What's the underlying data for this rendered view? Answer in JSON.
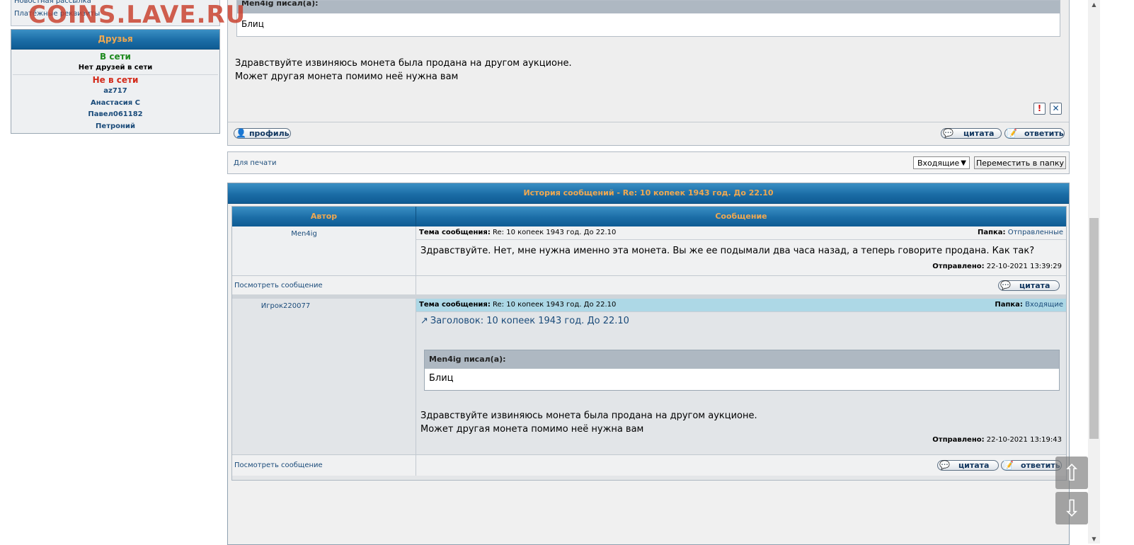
{
  "watermark": "COINS.LAVE.RU",
  "sidebar": {
    "top_links": [
      "Новостная рассылка",
      "Платёжные реквизиты"
    ],
    "friends": {
      "title": "Друзья",
      "online_label": "В сети",
      "no_friends_online": "Нет друзей в сети",
      "offline_label": "Не в сети",
      "offline_names": [
        "az717",
        "Анастасия С",
        "Павел061182",
        "Петроний"
      ]
    }
  },
  "top_post": {
    "quote_header": "Men4ig писал(а):",
    "quote_body": "Блиц",
    "body_lines": [
      "Здравствуйте извиняюсь монета была продана на другом аукционе.",
      "Может другая монета помимо неё нужна вам"
    ],
    "report_icon": "!",
    "delete_icon": "✕",
    "profile_button": "профиль",
    "quote_button": "цитата",
    "reply_button": "ответить"
  },
  "print_bar": {
    "print_link": "Для печати",
    "folder_selected": "Входящие",
    "move_button": "Переместить в папку"
  },
  "history": {
    "title": "История сообщений - Re: 10 копеек 1943 год. До 22.10",
    "col_author": "Автор",
    "col_message": "Сообщение",
    "topic_label": "Тема сообщения:",
    "folder_label": "Папка:",
    "sent_label": "Отправлено:",
    "view_link": "Посмотреть сообщение",
    "quote_button": "цитата",
    "reply_button": "ответить",
    "messages": [
      {
        "author": "Men4ig",
        "topic": "Re: 10 копеек 1943 год. До 22.10",
        "folder": "Отправленные",
        "body": "Здравствуйте. Нет, мне нужна именно эта монета. Вы же ее подымали два часа назад, а теперь говорите продана. Как так?",
        "sent": "22-10-2021 13:39:29"
      },
      {
        "author": "Игрок220077",
        "topic": "Re: 10 копеек 1943 год. До 22.10",
        "folder": "Входящие",
        "heading": "Заголовок: 10 копеек 1943 год. До 22.10",
        "quote_header": "Men4ig писал(а):",
        "quote_body": "Блиц",
        "body_lines": [
          "Здравствуйте извиняюсь монета была продана на другом аукционе.",
          "Может другая монета помимо неё нужна вам"
        ],
        "sent": "22-10-2021 13:19:43"
      }
    ]
  },
  "scroll_buttons": {
    "up": "⇧",
    "down": "⇩"
  }
}
